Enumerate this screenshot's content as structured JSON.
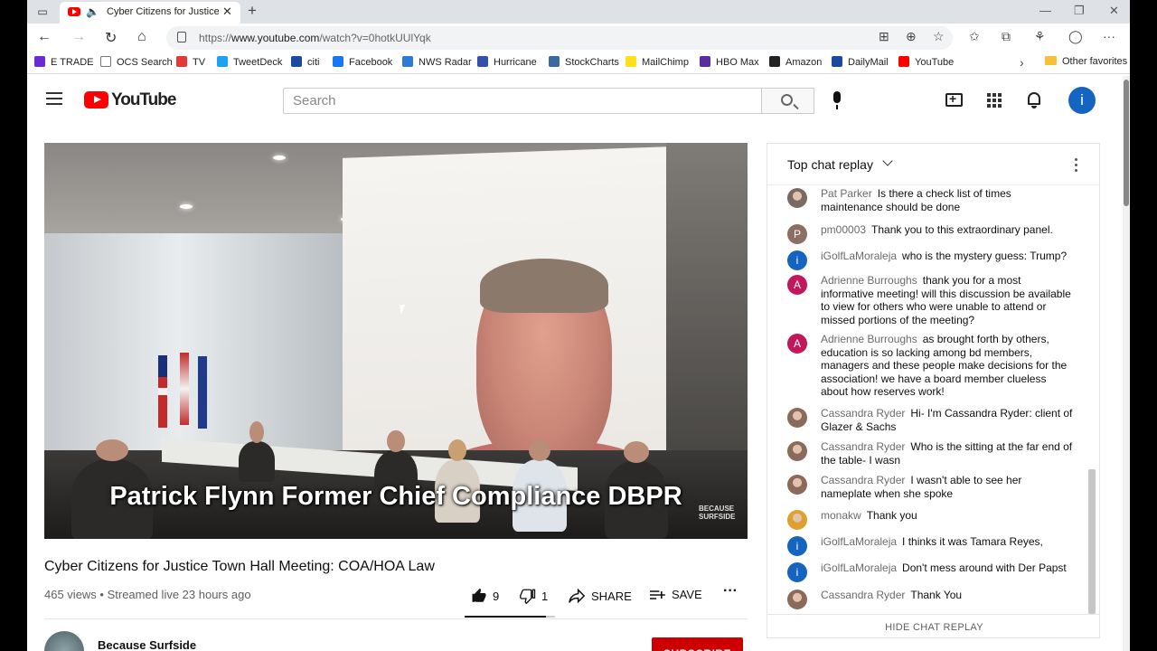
{
  "browser": {
    "tab_title": "Cyber Citizens for Justice To",
    "url_prefix": "https://",
    "url_host": "www.youtube.com",
    "url_path": "/watch?v=0hotkUUlYqk",
    "bookmarks": [
      {
        "label": "E TRADE",
        "color": "#6b2bd1"
      },
      {
        "label": "OCS Search",
        "color": "#ffffff"
      },
      {
        "label": "TV",
        "color": "#e53935"
      },
      {
        "label": "TweetDeck",
        "color": "#1da1f2"
      },
      {
        "label": "citi",
        "color": "#1b4aa0"
      },
      {
        "label": "Facebook",
        "color": "#1877f2"
      },
      {
        "label": "NWS Radar",
        "color": "#2c7bd6"
      },
      {
        "label": "Hurricane",
        "color": "#3251a8"
      },
      {
        "label": "StockCharts",
        "color": "#3b6aa0"
      },
      {
        "label": "MailChimp",
        "color": "#ffe01b"
      },
      {
        "label": "HBO Max",
        "color": "#5a2ca0"
      },
      {
        "label": "Amazon",
        "color": "#222222"
      },
      {
        "label": "DailyMail",
        "color": "#1b4aa0"
      },
      {
        "label": "YouTube",
        "color": "#ff0000"
      }
    ],
    "other_favorites": "Other favorites"
  },
  "masthead": {
    "logo_text": "YouTube",
    "search_placeholder": "Search",
    "avatar_initial": "i"
  },
  "video": {
    "caption": "Patrick Flynn Former Chief Compliance  DBPR",
    "watermark_line1": "BECAUSE",
    "watermark_line2": "SURFSIDE",
    "title": "Cyber Citizens for Justice Town Hall Meeting: COA/HOA Law",
    "meta": "465 views • Streamed live 23 hours ago",
    "likes": "9",
    "dislikes": "1",
    "like_ratio": 0.9,
    "share_label": "SHARE",
    "save_label": "SAVE",
    "channel_name": "Because Surfside",
    "subscribe_label": "SUBSCRIBE"
  },
  "chat": {
    "title": "Top chat replay",
    "hide_label": "HIDE CHAT REPLAY",
    "messages": [
      {
        "author": "Pat Parker",
        "text": "Is there a check list of times maintenance should be done",
        "avatar": "photo",
        "color": "#7a6a62"
      },
      {
        "author": "pm00003",
        "text": "Thank you to this extraordinary panel.",
        "avatar": "P",
        "color": "#8d6e63"
      },
      {
        "author": "iGolfLaMoraleja",
        "text": "who is the mystery guess: Trump?",
        "avatar": "i",
        "color": "#1565c0"
      },
      {
        "author": "Adrienne Burroughs",
        "text": "thank you for a most informative meeting! will this discussion be available to view for others who were unable to attend or missed portions of the meeting?",
        "avatar": "A",
        "color": "#c2185b"
      },
      {
        "author": "Adrienne Burroughs",
        "text": "as brought forth by others, education is so lacking among bd members, managers and these people make decisions for the association! we have a board member clueless about how reserves work!",
        "avatar": "A",
        "color": "#c2185b"
      },
      {
        "author": "Cassandra Ryder",
        "text": "Hi- I'm Cassandra Ryder: client of Glazer & Sachs",
        "avatar": "photo",
        "color": "#8a6a5a"
      },
      {
        "author": "Cassandra Ryder",
        "text": "Who is the sitting at the far end of the table- I wasn",
        "avatar": "photo",
        "color": "#8a6a5a"
      },
      {
        "author": "Cassandra Ryder",
        "text": "I wasn't able to see her nameplate when she spoke",
        "avatar": "photo",
        "color": "#8a6a5a"
      },
      {
        "author": "monakw",
        "text": "Thank you",
        "avatar": "photo",
        "color": "#e0a030"
      },
      {
        "author": "iGolfLaMoraleja",
        "text": "I thinks it was Tamara Reyes,",
        "avatar": "i",
        "color": "#1565c0"
      },
      {
        "author": "iGolfLaMoraleja",
        "text": "Don't mess around with Der Papst",
        "avatar": "i",
        "color": "#1565c0"
      },
      {
        "author": "Cassandra Ryder",
        "text": "Thank You",
        "avatar": "photo",
        "color": "#8a6a5a"
      }
    ]
  }
}
